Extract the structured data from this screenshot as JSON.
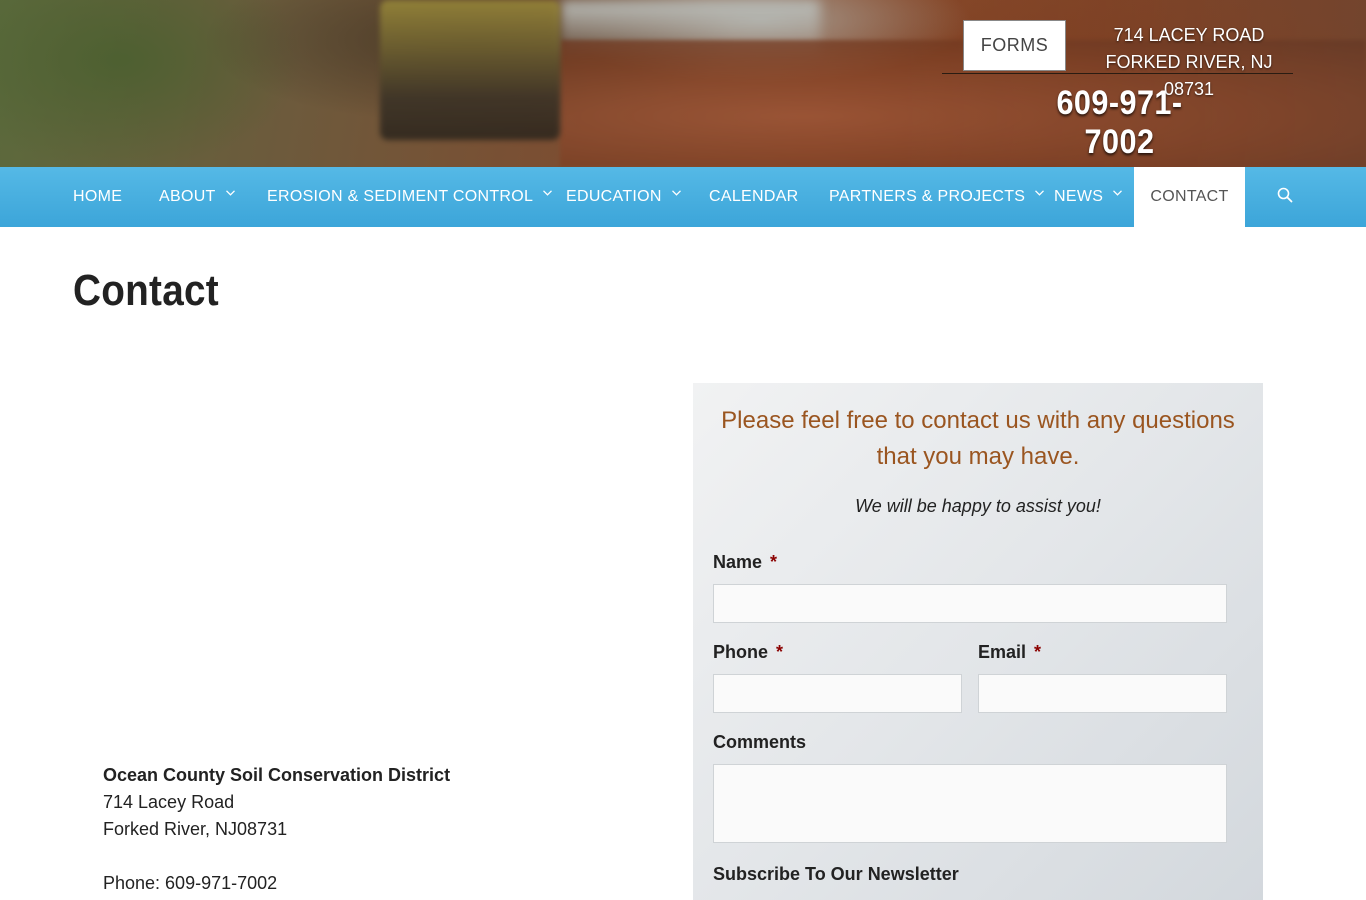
{
  "header": {
    "forms_label": "FORMS",
    "address_line1": "714 LACEY ROAD",
    "address_line2": "FORKED RIVER, NJ 08731",
    "phone": "609-971-7002"
  },
  "nav": {
    "items": [
      {
        "label": "HOME",
        "has_dropdown": false
      },
      {
        "label": "ABOUT",
        "has_dropdown": true
      },
      {
        "label": "EROSION & SEDIMENT CONTROL",
        "has_dropdown": true
      },
      {
        "label": "EDUCATION",
        "has_dropdown": true
      },
      {
        "label": "CALENDAR",
        "has_dropdown": false
      },
      {
        "label": "PARTNERS & PROJECTS",
        "has_dropdown": true
      },
      {
        "label": "NEWS",
        "has_dropdown": true
      },
      {
        "label": "CONTACT",
        "has_dropdown": false,
        "active": true
      }
    ],
    "search_icon": "search-icon",
    "color": "#3ca5d9"
  },
  "page": {
    "title": "Contact"
  },
  "contact_info": {
    "org_name": "Ocean County Soil Conservation District",
    "street": "714 Lacey Road",
    "city": "Forked River, NJ08731",
    "phone": "Phone: 609-971-7002"
  },
  "form": {
    "heading": "Please feel free to contact us with any questions that you may have.",
    "subheading": "We will be happy to assist you!",
    "required_marker": "*",
    "name_label": "Name",
    "name_value": "",
    "phone_label": "Phone",
    "phone_value": "",
    "email_label": "Email",
    "email_value": "",
    "comments_label": "Comments",
    "comments_value": "",
    "newsletter_label": "Subscribe To Our Newsletter",
    "heading_color": "#9a5520"
  }
}
